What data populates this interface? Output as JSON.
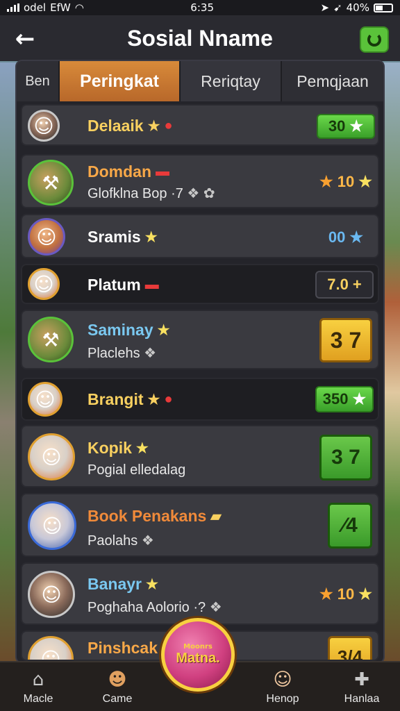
{
  "status_bar": {
    "carrier": "odel",
    "network": "EfW",
    "time": "6:35",
    "battery": "40%"
  },
  "header": {
    "title": "Sosial Nname"
  },
  "tabs": [
    {
      "label": "Ben"
    },
    {
      "label": "Peringkat"
    },
    {
      "label": "Reriqtay"
    },
    {
      "label": "Pemqjaan"
    }
  ],
  "rows": [
    {
      "name": "Delaaik",
      "subtitle": "",
      "score": "30",
      "score_style": "green-pill"
    },
    {
      "name": "Domdan",
      "subtitle": "Glofklna Bop ·7",
      "score": "10",
      "score_style": "plain"
    },
    {
      "name": "Sramis",
      "subtitle": "",
      "score": "00",
      "score_style": "blue"
    },
    {
      "name": "Platum",
      "subtitle": "",
      "score": "7.0 +",
      "score_style": "dark-pill"
    },
    {
      "name": "Saminay",
      "subtitle": "Placlehs",
      "score": "3 7",
      "score_style": "gold-box"
    },
    {
      "name": "Brangit",
      "subtitle": "",
      "score": "350",
      "score_style": "green-pill"
    },
    {
      "name": "Kopik",
      "subtitle": "Pogial elledalag",
      "score": "3 7",
      "score_style": "green-box"
    },
    {
      "name": "Book Penakans",
      "subtitle": "Paolahs",
      "score": "⁄4",
      "score_style": "green-box"
    },
    {
      "name": "Banayr",
      "subtitle": "Poghaha Aolorio ·?",
      "score": "10",
      "score_style": "plain"
    },
    {
      "name": "Pinshcak",
      "subtitle": "",
      "score": "3/4",
      "score_style": "gold-box"
    }
  ],
  "bottom_nav": {
    "items": [
      {
        "label": "Macle"
      },
      {
        "label": "Came"
      },
      {
        "label": "Henop"
      },
      {
        "label": "Hanlaa"
      }
    ],
    "main_button": {
      "small": "Moonrs",
      "label": "Matna."
    }
  }
}
